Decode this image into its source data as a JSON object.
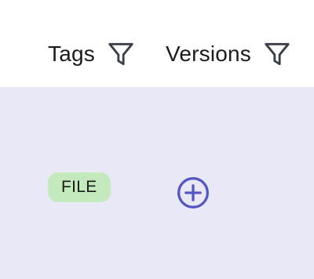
{
  "table": {
    "columns": [
      {
        "label": "Tags",
        "filter_icon": "filter-icon"
      },
      {
        "label": "Versions",
        "filter_icon": "filter-icon"
      }
    ],
    "rows": [
      {
        "tag": "FILE",
        "versions_action_icon": "add-circle-icon"
      }
    ]
  },
  "colors": {
    "header_bg": "#ffffff",
    "row_bg": "#e9e8f6",
    "tag_chip_bg": "#c3e9bd",
    "accent": "#5558c2",
    "icon_dark": "#3a3f4a"
  }
}
